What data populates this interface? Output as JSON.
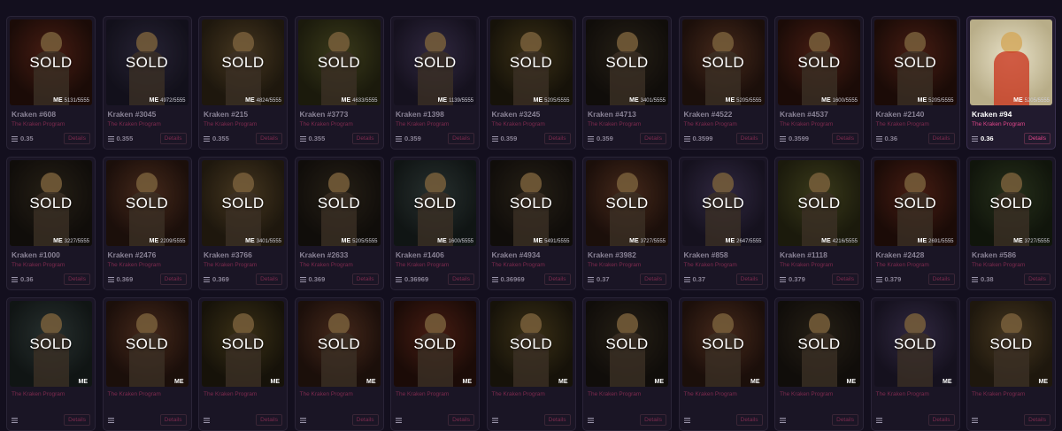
{
  "sold_label": "SOLD",
  "collection_name": "The Kraken Program",
  "details_label": "Details",
  "rank_brand": "ME",
  "cards": [
    {
      "name": "Kraken #608",
      "rank": "5131/5555",
      "price": "0.35",
      "sold": true,
      "theme": "bg-red"
    },
    {
      "name": "Kraken #3045",
      "rank": "4972/5555",
      "price": "0.355",
      "sold": true,
      "theme": "bg-indigo"
    },
    {
      "name": "Kraken #215",
      "rank": "4824/5555",
      "price": "0.355",
      "sold": true,
      "theme": "bg-tan"
    },
    {
      "name": "Kraken #3773",
      "rank": "4633/5555",
      "price": "0.355",
      "sold": true,
      "theme": "bg-olive"
    },
    {
      "name": "Kraken #1398",
      "rank": "1139/5555",
      "price": "0.359",
      "sold": true,
      "theme": "bg-purple"
    },
    {
      "name": "Kraken #3245",
      "rank": "5205/5555",
      "price": "0.359",
      "sold": true,
      "theme": "bg-gold"
    },
    {
      "name": "Kraken #4713",
      "rank": "3401/5555",
      "price": "0.359",
      "sold": true,
      "theme": "bg-dark"
    },
    {
      "name": "Kraken #4522",
      "rank": "5205/5555",
      "price": "0.3599",
      "sold": true,
      "theme": "bg-brown"
    },
    {
      "name": "Kraken #4537",
      "rank": "1600/5555",
      "price": "0.3599",
      "sold": true,
      "theme": "bg-red"
    },
    {
      "name": "Kraken #2140",
      "rank": "5205/5555",
      "price": "0.36",
      "sold": true,
      "theme": "bg-red"
    },
    {
      "name": "Kraken #94",
      "rank": "5205/5555",
      "price": "0.36",
      "sold": false,
      "theme": "bg-cream",
      "active": true
    },
    {
      "name": "Kraken #1000",
      "rank": "3227/5555",
      "price": "0.36",
      "sold": true,
      "theme": "bg-dark"
    },
    {
      "name": "Kraken #2476",
      "rank": "2209/5555",
      "price": "0.369",
      "sold": true,
      "theme": "bg-brown"
    },
    {
      "name": "Kraken #3766",
      "rank": "3401/5555",
      "price": "0.369",
      "sold": true,
      "theme": "bg-tan"
    },
    {
      "name": "Kraken #2633",
      "rank": "5205/5555",
      "price": "0.369",
      "sold": true,
      "theme": "bg-dark"
    },
    {
      "name": "Kraken #1406",
      "rank": "1600/5555",
      "price": "0.36969",
      "sold": true,
      "theme": "bg-teal"
    },
    {
      "name": "Kraken #4934",
      "rank": "5491/5555",
      "price": "0.36969",
      "sold": true,
      "theme": "bg-dark"
    },
    {
      "name": "Kraken #3982",
      "rank": "3727/5555",
      "price": "0.37",
      "sold": true,
      "theme": "bg-brown"
    },
    {
      "name": "Kraken #858",
      "rank": "2647/5555",
      "price": "0.37",
      "sold": true,
      "theme": "bg-purple"
    },
    {
      "name": "Kraken #1118",
      "rank": "4216/5555",
      "price": "0.379",
      "sold": true,
      "theme": "bg-olive"
    },
    {
      "name": "Kraken #2428",
      "rank": "2691/5555",
      "price": "0.379",
      "sold": true,
      "theme": "bg-red"
    },
    {
      "name": "Kraken #586",
      "rank": "3727/5555",
      "price": "0.38",
      "sold": true,
      "theme": "bg-green"
    },
    {
      "name": "",
      "rank": "",
      "price": "",
      "sold": true,
      "theme": "bg-teal"
    },
    {
      "name": "",
      "rank": "",
      "price": "",
      "sold": true,
      "theme": "bg-brown"
    },
    {
      "name": "",
      "rank": "",
      "price": "",
      "sold": true,
      "theme": "bg-gold"
    },
    {
      "name": "",
      "rank": "",
      "price": "",
      "sold": true,
      "theme": "bg-brown"
    },
    {
      "name": "",
      "rank": "",
      "price": "",
      "sold": true,
      "theme": "bg-red"
    },
    {
      "name": "",
      "rank": "",
      "price": "",
      "sold": true,
      "theme": "bg-gold"
    },
    {
      "name": "",
      "rank": "",
      "price": "",
      "sold": true,
      "theme": "bg-dark"
    },
    {
      "name": "",
      "rank": "",
      "price": "",
      "sold": true,
      "theme": "bg-brown"
    },
    {
      "name": "",
      "rank": "",
      "price": "",
      "sold": true,
      "theme": "bg-dark"
    },
    {
      "name": "",
      "rank": "",
      "price": "",
      "sold": true,
      "theme": "bg-purple"
    },
    {
      "name": "",
      "rank": "",
      "price": "",
      "sold": true,
      "theme": "bg-tan"
    }
  ]
}
